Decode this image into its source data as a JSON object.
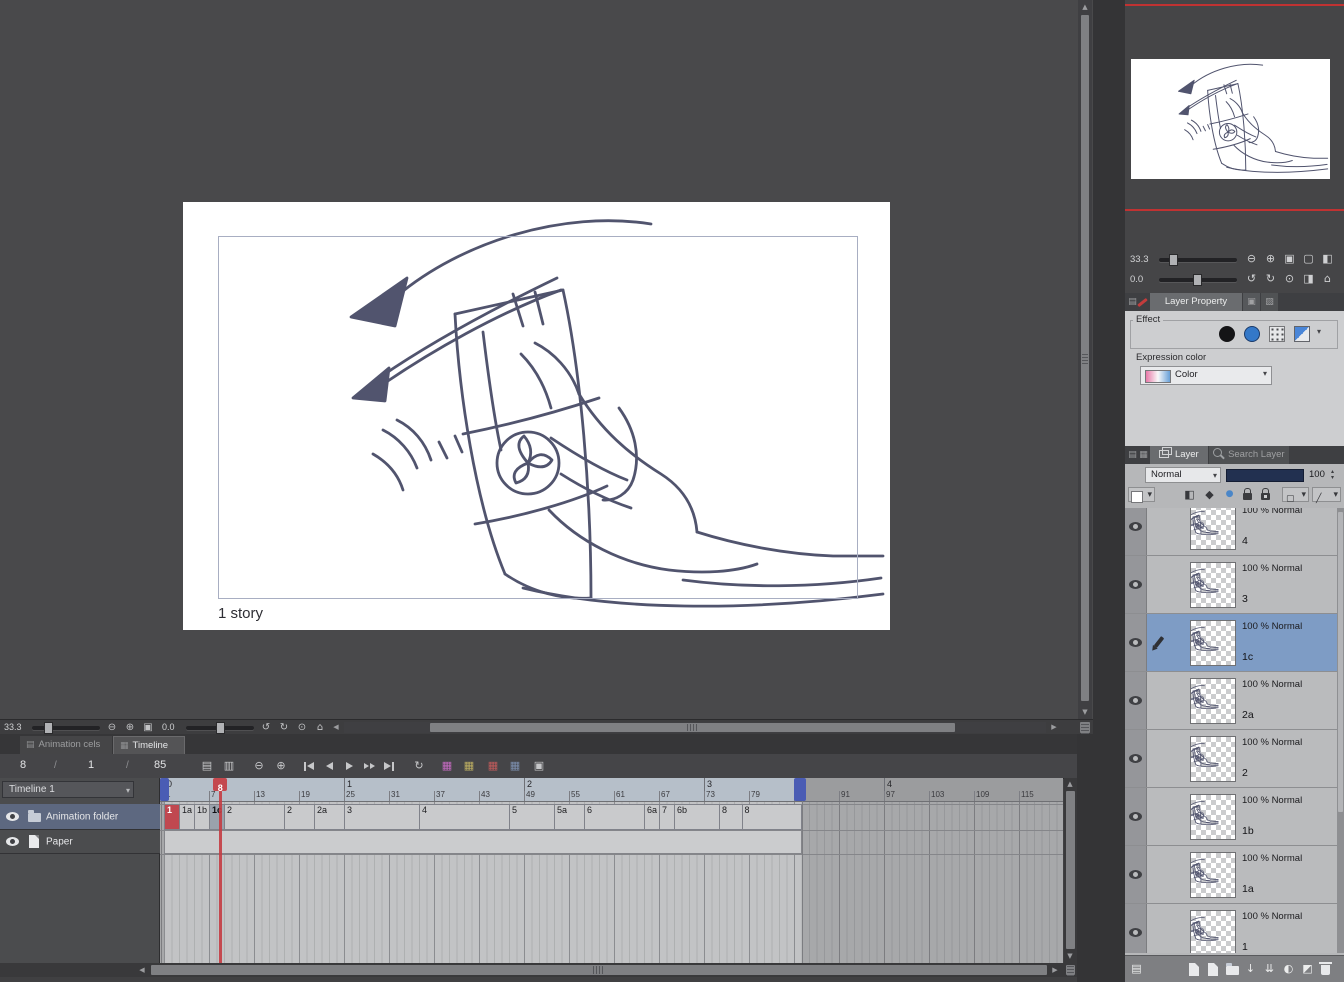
{
  "canvas": {
    "caption": "1 story"
  },
  "canvas_bar": {
    "zoom_value": "33.3",
    "rotation_value": "0.0"
  },
  "navigator": {
    "zoom_value": "33.3",
    "rotation_value": "0.0"
  },
  "layer_property": {
    "panel_tab": "Layer Property",
    "effect_group_label": "Effect",
    "expression_color_label": "Expression color",
    "expression_color_value": "Color"
  },
  "layer_panel": {
    "tab_layer": "Layer",
    "tab_search_layer": "Search Layer",
    "blend_mode": "Normal",
    "opacity_value": "100",
    "layers": [
      {
        "mode": "100 % Normal",
        "name": "4",
        "selected": false,
        "editing": false
      },
      {
        "mode": "100 % Normal",
        "name": "3",
        "selected": false,
        "editing": false
      },
      {
        "mode": "100 % Normal",
        "name": "1c",
        "selected": true,
        "editing": true
      },
      {
        "mode": "100 % Normal",
        "name": "2a",
        "selected": false,
        "editing": false
      },
      {
        "mode": "100 % Normal",
        "name": "2",
        "selected": false,
        "editing": false
      },
      {
        "mode": "100 % Normal",
        "name": "1b",
        "selected": false,
        "editing": false
      },
      {
        "mode": "100 % Normal",
        "name": "1a",
        "selected": false,
        "editing": false
      },
      {
        "mode": "100 % Normal",
        "name": "1",
        "selected": false,
        "editing": false
      }
    ]
  },
  "timeline": {
    "tabs": [
      {
        "label": "Animation cels",
        "active": false
      },
      {
        "label": "Timeline",
        "active": true
      }
    ],
    "frame_display": {
      "current": "8",
      "separator": "/",
      "start": "1",
      "end": "85"
    },
    "timeline_selector": "Timeline 1",
    "current_frame_label": "8",
    "playhead_frame": 8,
    "range_start": 1,
    "range_end": 85,
    "fps_seconds": [
      {
        "label": "0",
        "frame": 1
      },
      {
        "label": "1",
        "frame": 25
      },
      {
        "label": "2",
        "frame": 49
      },
      {
        "label": "3",
        "frame": 73
      },
      {
        "label": "4",
        "frame": 97
      }
    ],
    "frame_ticks": [
      1,
      7,
      13,
      19,
      25,
      31,
      37,
      43,
      49,
      55,
      61,
      67,
      73,
      79,
      85,
      91,
      97,
      103,
      109,
      115
    ],
    "tracks": [
      {
        "label": "Animation folder",
        "icon": "animation-folder-icon",
        "selected": true
      },
      {
        "label": "Paper",
        "icon": "paper-icon",
        "selected": false
      }
    ],
    "cels": [
      {
        "label": "1",
        "frame": 1,
        "state": "current"
      },
      {
        "label": "1a",
        "frame": 3
      },
      {
        "label": "1b",
        "frame": 5
      },
      {
        "label": "1c",
        "frame": 7,
        "state": "selected"
      },
      {
        "label": "2",
        "frame": 9
      },
      {
        "label": "2",
        "frame": 17
      },
      {
        "label": "2a",
        "frame": 21
      },
      {
        "label": "3",
        "frame": 25
      },
      {
        "label": "4",
        "frame": 35
      },
      {
        "label": "5",
        "frame": 47
      },
      {
        "label": "5a",
        "frame": 53
      },
      {
        "label": "6",
        "frame": 57
      },
      {
        "label": "6a",
        "frame": 65
      },
      {
        "label": "7",
        "frame": 67
      },
      {
        "label": "6b",
        "frame": 69
      },
      {
        "label": "8",
        "frame": 75
      },
      {
        "label": "8",
        "frame": 78
      }
    ]
  },
  "colors": {
    "playhead_red": "#c4484e",
    "range_blue": "#4a5cb4",
    "layer_selection_blue": "#7e9cc5",
    "navigator_guide_red": "#c03232",
    "canvas_background": "#49494b"
  },
  "icons": {
    "zoom_out": "⊖",
    "zoom_in": "⊕",
    "fit_screen": "▣",
    "actual_size": "▢",
    "flip_horizontal": "◧",
    "rotate_ccw": "↺",
    "rotate_cw": "↻",
    "reset_rotation": "⊙",
    "flip_vertical": "◨",
    "reset_display": "⌂",
    "dropdown": "▾",
    "spin_up": "▴",
    "spin_down": "▾",
    "panel_menu": "▤",
    "panel_grid": "▦",
    "tab_stub_a": "▣",
    "tab_stub_b": "▨",
    "clip_below": "◧",
    "reference": "◆",
    "draft": "●",
    "selection_source": "▢",
    "ruler_tool": "╱",
    "show_cels": "▤",
    "show_frames": "▥",
    "loop": "↻",
    "new_cel": "▦",
    "specify_cels": "▦",
    "onion_skin": "▦",
    "export_cels": "▦",
    "settings": "▣",
    "transfer_down": "↓",
    "merge_down": "⇊",
    "mask": "◐",
    "apply_mask": "◩",
    "arrow_left": "◀",
    "arrow_right": "▶",
    "arrow_up": "▲",
    "arrow_down": "▼"
  }
}
